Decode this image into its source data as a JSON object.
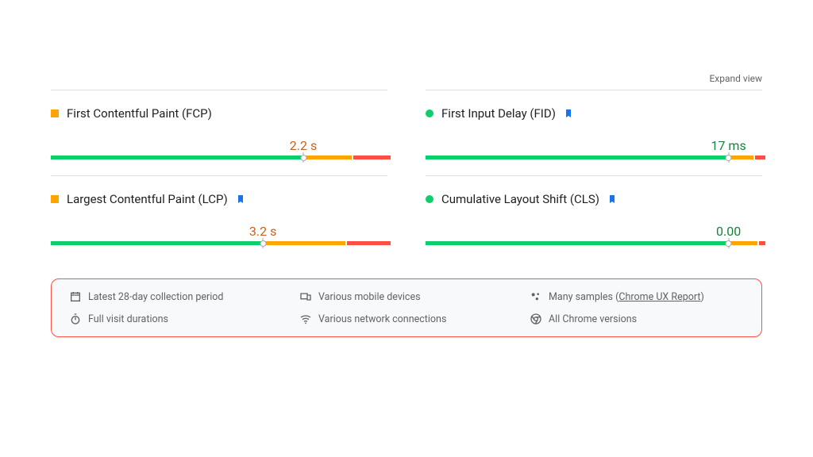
{
  "header": {
    "expand_label": "Expand view"
  },
  "colors": {
    "good": "#0cce6b",
    "avg": "#ffa400",
    "poor": "#ff4e42"
  },
  "metrics": [
    {
      "title": "First Contentful Paint (FCP)",
      "status": "avg",
      "value": "2.2 s",
      "value_color": "orange",
      "bookmark": false,
      "marker_pct": 75,
      "segments": [
        {
          "color": "green",
          "pct": 75
        },
        {
          "color": "orange",
          "pct": 14
        },
        {
          "color": "red",
          "pct": 11
        }
      ]
    },
    {
      "title": "First Input Delay (FID)",
      "status": "good",
      "value": "17 ms",
      "value_color": "green",
      "bookmark": true,
      "marker_pct": 90,
      "segments": [
        {
          "color": "green",
          "pct": 90
        },
        {
          "color": "orange",
          "pct": 7
        },
        {
          "color": "red",
          "pct": 3
        }
      ]
    },
    {
      "title": "Largest Contentful Paint (LCP)",
      "status": "avg",
      "value": "3.2 s",
      "value_color": "orange",
      "bookmark": true,
      "marker_pct": 63,
      "segments": [
        {
          "color": "green",
          "pct": 63
        },
        {
          "color": "orange",
          "pct": 24
        },
        {
          "color": "red",
          "pct": 13
        }
      ]
    },
    {
      "title": "Cumulative Layout Shift (CLS)",
      "status": "good",
      "value": "0.00",
      "value_color": "green",
      "bookmark": true,
      "marker_pct": 90,
      "segments": [
        {
          "color": "green",
          "pct": 90
        },
        {
          "color": "orange",
          "pct": 8
        },
        {
          "color": "red",
          "pct": 2
        }
      ]
    }
  ],
  "footer": {
    "items": [
      {
        "icon": "calendar-icon",
        "text": "Latest 28-day collection period"
      },
      {
        "icon": "devices-icon",
        "text": "Various mobile devices"
      },
      {
        "icon": "cluster-icon",
        "text_prefix": "Many samples (",
        "link_text": "Chrome UX Report",
        "text_suffix": ")"
      },
      {
        "icon": "stopwatch-icon",
        "text": "Full visit durations"
      },
      {
        "icon": "wifi-icon",
        "text": "Various network connections"
      },
      {
        "icon": "chrome-icon",
        "text": "All Chrome versions"
      }
    ]
  }
}
